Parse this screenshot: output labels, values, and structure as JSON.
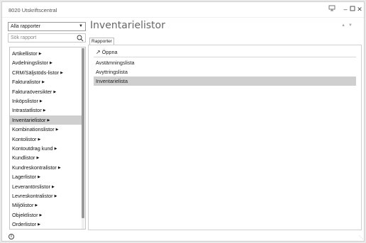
{
  "window": {
    "title": "8020 Utskriftscentral"
  },
  "sidebar": {
    "filter_value": "Alla rapporter",
    "search_placeholder": "Sök rapport",
    "items": [
      {
        "label": "Artikellistor"
      },
      {
        "label": "Avdelningslistor"
      },
      {
        "label": "CRM/Säljstöds-listor"
      },
      {
        "label": "Fakturalistor"
      },
      {
        "label": "Fakturaöversikter"
      },
      {
        "label": "Inköpslistor"
      },
      {
        "label": "Intrastatlistor"
      },
      {
        "label": "Inventarielistor"
      },
      {
        "label": "Kombinationslistor"
      },
      {
        "label": "Kontolistor"
      },
      {
        "label": "Kontoutdrag kund"
      },
      {
        "label": "Kundlistor"
      },
      {
        "label": "Kundreskontralistor"
      },
      {
        "label": "Lagerlistor"
      },
      {
        "label": "Leverantörslistor"
      },
      {
        "label": "Levreskontralistor"
      },
      {
        "label": "Miljölistor"
      },
      {
        "label": "Objektlistor"
      },
      {
        "label": "Orderlistor"
      }
    ],
    "selected_index": 7
  },
  "main": {
    "heading": "Inventarielistor",
    "tab_label": "Rapporter",
    "open_label": "Öppna",
    "reports": [
      {
        "label": "Avstämningslista"
      },
      {
        "label": "Avyttringslista"
      },
      {
        "label": "Inventarielista"
      }
    ],
    "selected_report": 2
  },
  "colors": {
    "selection": "#cfcfcf",
    "heading": "#666666",
    "scrollbar": "#9a9a9a"
  },
  "icons": {
    "window_controls": [
      "monitor-icon",
      "minimize-icon",
      "maximize-icon",
      "close-icon"
    ],
    "status": "info-icon"
  }
}
